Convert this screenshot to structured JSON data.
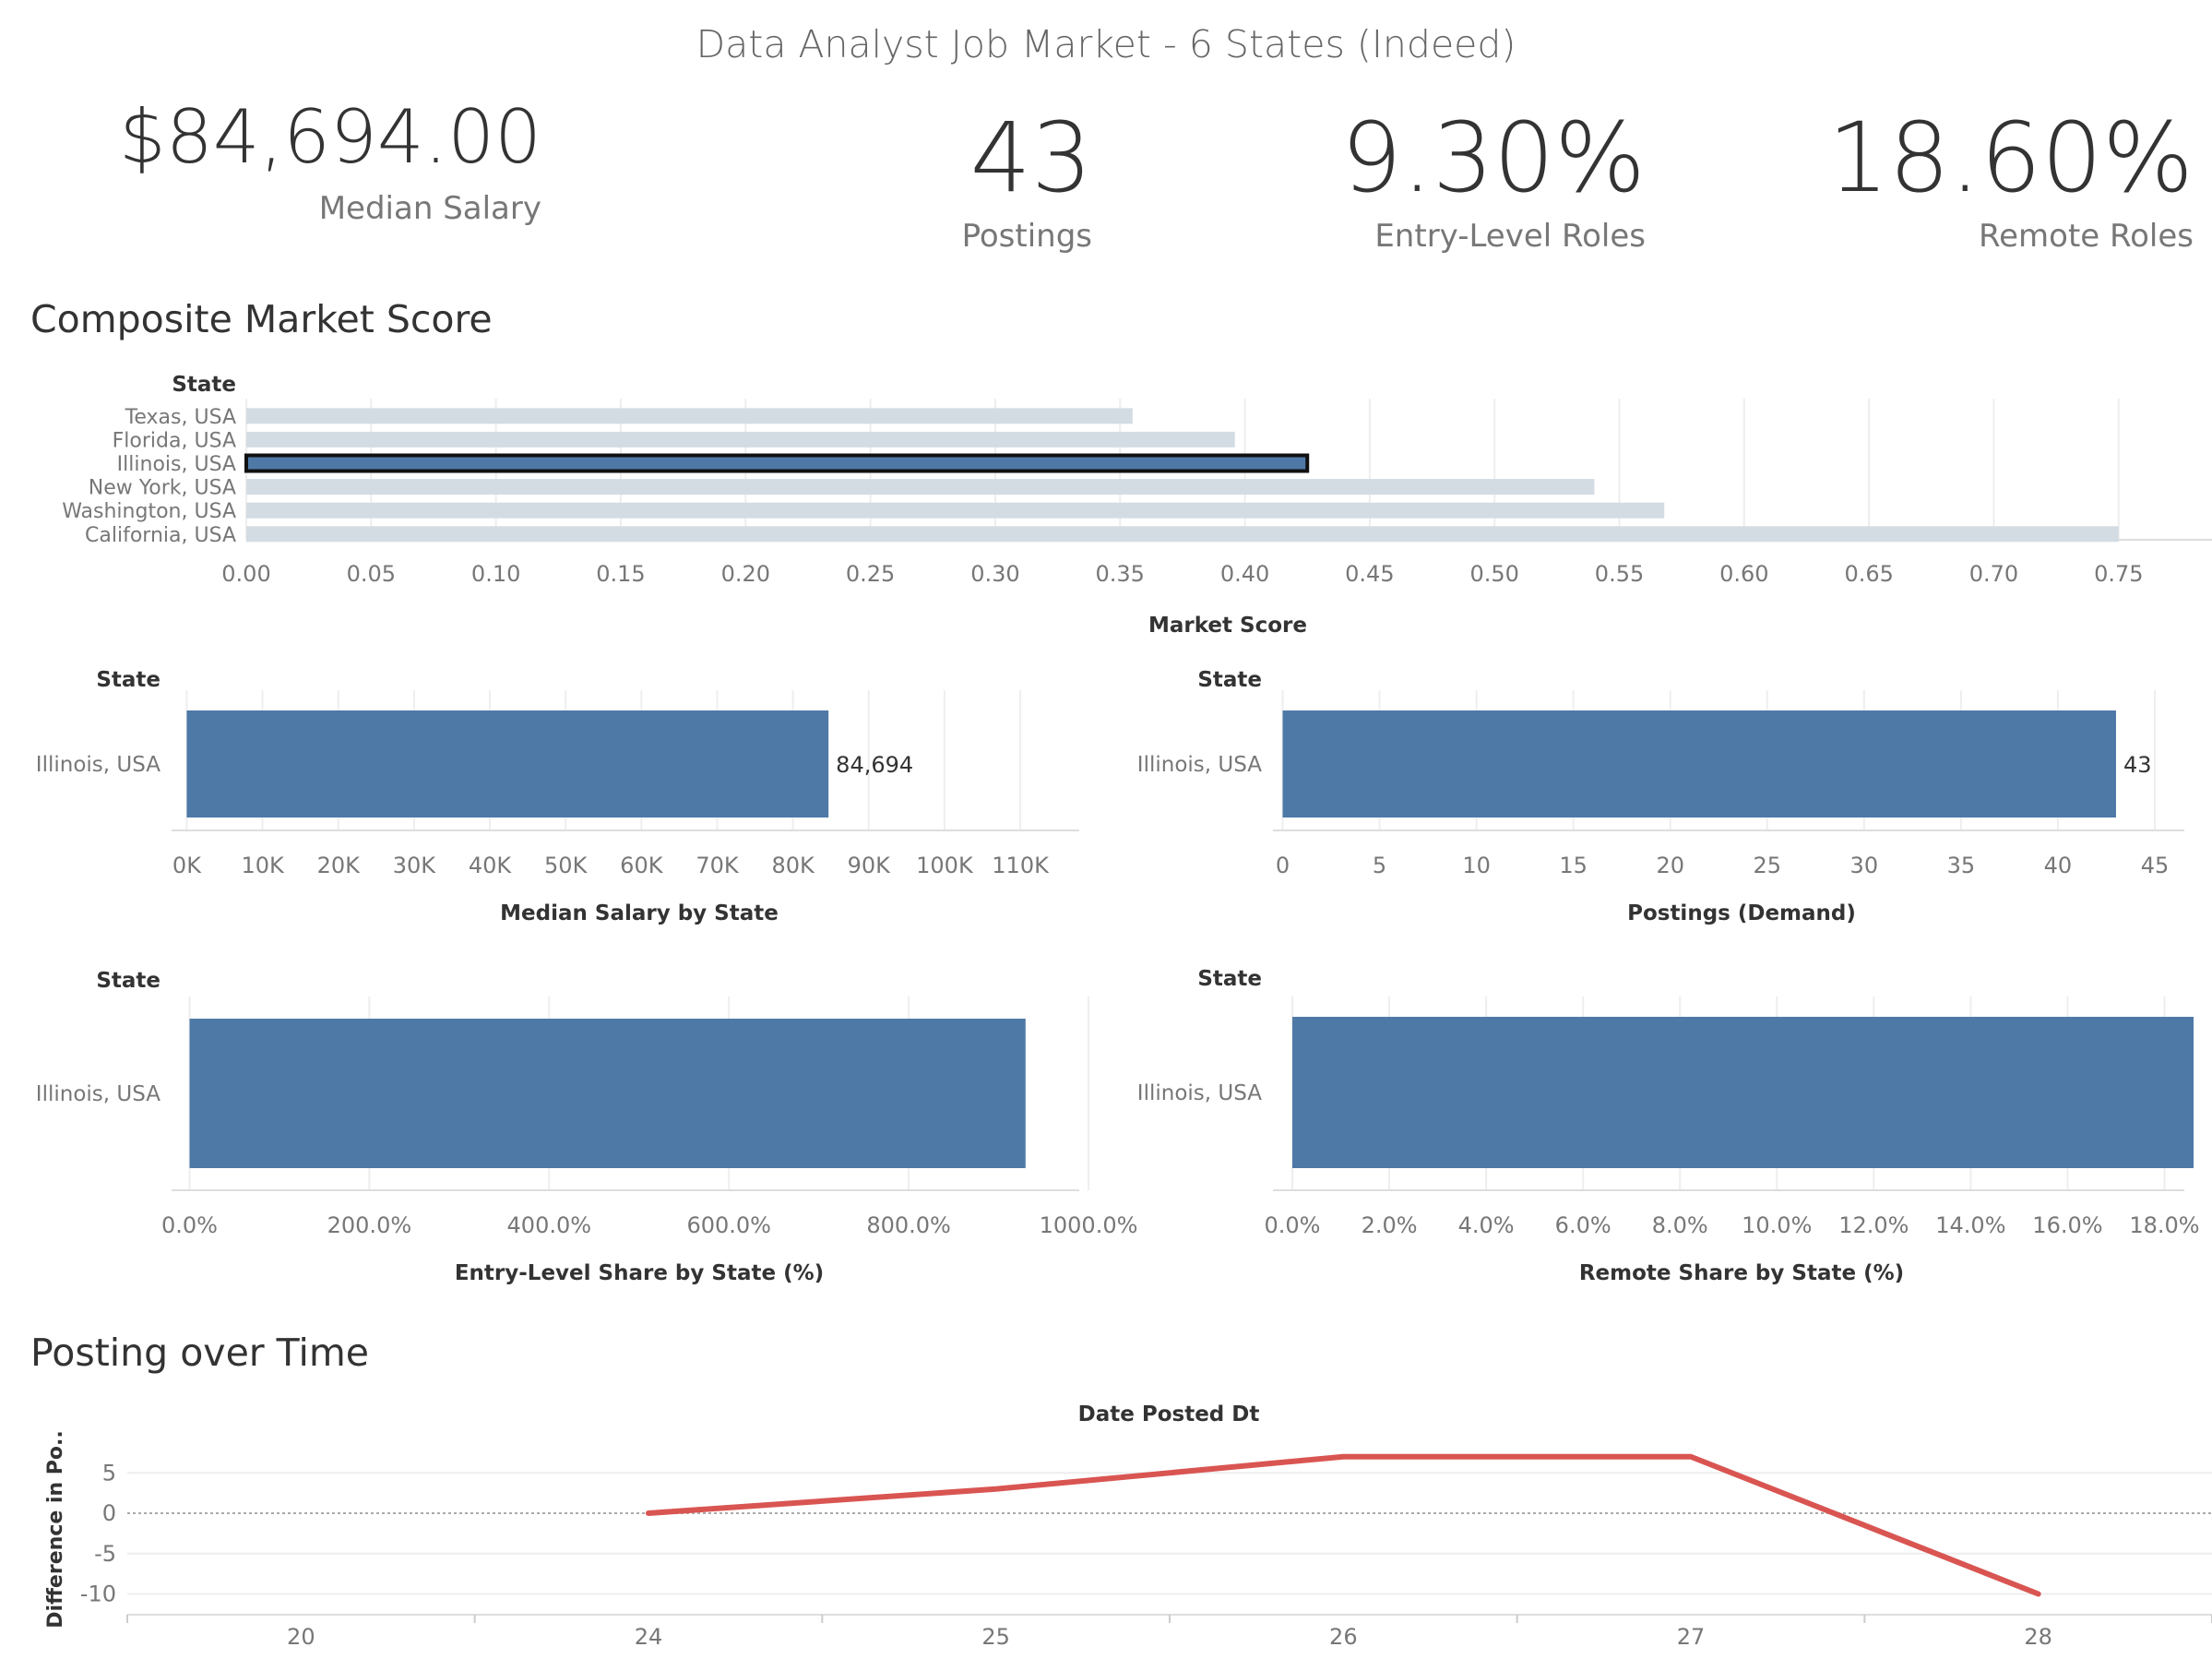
{
  "dashboard_title": "Data Analyst Job Market - 6 States (Indeed)",
  "kpis": {
    "median_salary": {
      "value": "$84,694.00",
      "label": "Median Salary"
    },
    "postings": {
      "value": "43",
      "label": "Postings"
    },
    "entry_level": {
      "value": "9.30%",
      "label": "Entry-Level Roles"
    },
    "remote": {
      "value": "18.60%",
      "label": "Remote Roles"
    }
  },
  "sections": {
    "composite": "Composite Market Score",
    "posting_time": "Posting over Time"
  },
  "colors": {
    "highlight": "#4e79a7",
    "muted": "#d4dce3",
    "line": "#d95552",
    "grid": "#eeeeee",
    "text": "#333333",
    "tick": "#777777"
  },
  "chart_data": [
    {
      "id": "composite",
      "type": "bar",
      "orientation": "horizontal",
      "row_header": "State",
      "categories": [
        "Texas, USA",
        "Florida, USA",
        "Illinois, USA",
        "New York, USA",
        "Washington, USA",
        "California, USA"
      ],
      "values": [
        0.355,
        0.396,
        0.425,
        0.54,
        0.568,
        0.75
      ],
      "highlighted": "Illinois, USA",
      "xlabel": "Market Score",
      "xlim": [
        0,
        0.78
      ],
      "ticks": [
        0,
        0.05,
        0.1,
        0.15,
        0.2,
        0.25,
        0.3,
        0.35,
        0.4,
        0.45,
        0.5,
        0.55,
        0.6,
        0.65,
        0.7,
        0.75
      ],
      "tick_labels": [
        "0.00",
        "0.05",
        "0.10",
        "0.15",
        "0.20",
        "0.25",
        "0.30",
        "0.35",
        "0.40",
        "0.45",
        "0.50",
        "0.55",
        "0.60",
        "0.65",
        "0.70",
        "0.75"
      ],
      "grid": true
    },
    {
      "id": "salary",
      "type": "bar",
      "orientation": "horizontal",
      "row_header": "State",
      "categories": [
        "Illinois, USA"
      ],
      "values": [
        84694
      ],
      "data_labels": [
        "84,694"
      ],
      "xlabel": "Median Salary by State",
      "xlim": [
        -2000,
        119000
      ],
      "ticks": [
        0,
        10000,
        20000,
        30000,
        40000,
        50000,
        60000,
        70000,
        80000,
        90000,
        100000,
        110000
      ],
      "tick_labels": [
        "0K",
        "10K",
        "20K",
        "30K",
        "40K",
        "50K",
        "60K",
        "70K",
        "80K",
        "90K",
        "100K",
        "110K"
      ],
      "grid": true
    },
    {
      "id": "postings",
      "type": "bar",
      "orientation": "horizontal",
      "row_header": "State",
      "categories": [
        "Illinois, USA"
      ],
      "values": [
        43
      ],
      "data_labels": [
        "43"
      ],
      "xlabel": "Postings (Demand)",
      "xlim": [
        -0.5,
        47
      ],
      "ticks": [
        0,
        5,
        10,
        15,
        20,
        25,
        30,
        35,
        40,
        45
      ],
      "tick_labels": [
        "0",
        "5",
        "10",
        "15",
        "20",
        "25",
        "30",
        "35",
        "40",
        "45"
      ],
      "grid": true
    },
    {
      "id": "entry",
      "type": "bar",
      "orientation": "horizontal",
      "row_header": "State",
      "categories": [
        "Illinois, USA"
      ],
      "values": [
        930
      ],
      "xlabel": "Entry-Level Share by State (%)",
      "xlim": [
        -20,
        1000
      ],
      "ticks": [
        0,
        200,
        400,
        600,
        800,
        1000
      ],
      "tick_labels": [
        "0.0%",
        "200.0%",
        "400.0%",
        "600.0%",
        "800.0%",
        "1000.0%"
      ],
      "grid": true
    },
    {
      "id": "remote",
      "type": "bar",
      "orientation": "horizontal",
      "row_header": "State",
      "categories": [
        "Illinois, USA"
      ],
      "values": [
        18.6
      ],
      "xlabel": "Remote Share by State (%)",
      "xlim": [
        -0.4,
        18.6
      ],
      "ticks": [
        0,
        2,
        4,
        6,
        8,
        10,
        12,
        14,
        16,
        18
      ],
      "tick_labels": [
        "0.0%",
        "2.0%",
        "4.0%",
        "6.0%",
        "8.0%",
        "10.0%",
        "12.0%",
        "14.0%",
        "16.0%",
        "18.0%"
      ],
      "grid": true
    },
    {
      "id": "timeline",
      "type": "line",
      "title": "Date Posted Dt",
      "ylabel": "Difference in Po..",
      "categories": [
        "20",
        "24",
        "25",
        "26",
        "27",
        "28"
      ],
      "x_domain": [
        19.5,
        28.5
      ],
      "series": [
        {
          "x": [
            24,
            25,
            26,
            27,
            28
          ],
          "values": [
            0,
            3,
            7,
            7,
            -10
          ]
        }
      ],
      "ylim": [
        -12,
        8
      ],
      "yticks": [
        5,
        0,
        -5,
        -10
      ],
      "ytick_labels": [
        "5",
        "0",
        "-5",
        "-10"
      ],
      "zero_line": true,
      "grid": true
    }
  ]
}
